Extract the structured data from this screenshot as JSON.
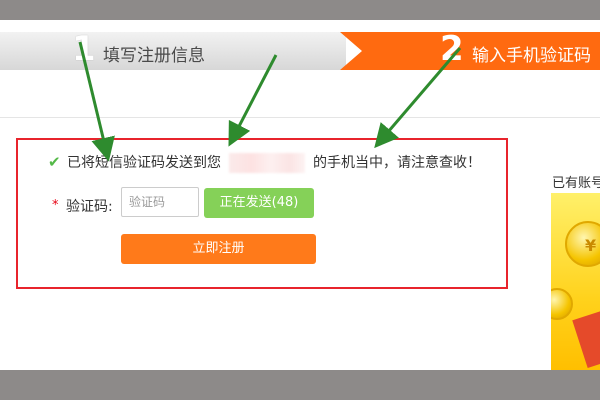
{
  "steps": [
    {
      "number": "1",
      "label": "填写注册信息",
      "state": "done"
    },
    {
      "number": "2",
      "label": "输入手机验证码",
      "state": "active"
    }
  ],
  "notice": {
    "prefix": "已将短信验证码发送到您",
    "suffix": "的手机当中，请注意查收！",
    "icon": "check-icon"
  },
  "form": {
    "code_label": "验证码:",
    "required_mark": "*",
    "code_placeholder": "验证码",
    "sending_label": "正在发送(48)",
    "register_label": "立即注册"
  },
  "sidebar": {
    "label": "已有账号"
  },
  "colors": {
    "accent_orange": "#ff6a10",
    "button_orange": "#ff7a1a",
    "sending_green": "#85d158",
    "check_green": "#54b948",
    "highlight_red": "#e8242c",
    "annotation_arrow_green": "#2e8b2e"
  }
}
